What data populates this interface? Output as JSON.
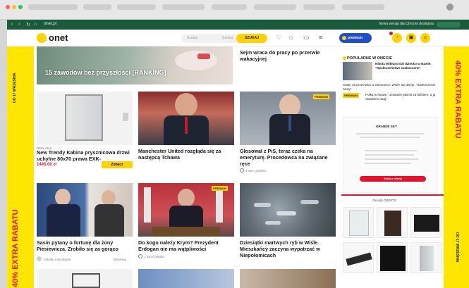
{
  "browser": {
    "url": "onet.pl",
    "update_notice": "Nowa wersja dla Chrome dostępna"
  },
  "header": {
    "logo": "onet",
    "search_placeholder": "Szukaj",
    "search_mid": "Szukaj",
    "search_button": "SZUKAJ",
    "premium_label": "premium"
  },
  "side_banner": {
    "left_big": "40% EXTRA RABATU",
    "left_small": "DO 17 WRZEŚNIA",
    "right_big": "40% EXTRA RABATU",
    "right_small": "DO 17 WRZEŚNIA"
  },
  "top_row": {
    "overlay_title": "15 zawodów bez przyszłości [RANKING]",
    "right_title": "Sejm wraca do pracy po przerwie wakacyjnej"
  },
  "row2": [
    {
      "title": "New Trendy Kabina prysznicowa drzwi uchylne 80x70 prawa EXK-",
      "price": "1445.00 zł",
      "button": "Zobacz",
      "meta": "REKLAMA"
    },
    {
      "title": "Manchester United rozgląda się za następcą Tchawa",
      "meta": ""
    },
    {
      "title": "Głosował z PiS, teraz czeka na emeryturę. Procedowca na związane ręce",
      "meta": "1 min czytania",
      "tag": "PREMIUM"
    }
  ],
  "row3": [
    {
      "title": "Sasin pytany o fortunę dla żony Piesiewicza. Zrobiło się za gorąco",
      "meta_left": "Szkoła, mieszkanie",
      "meta_right": "Obserwuj"
    },
    {
      "title": "Do kogo należy Krym? Prezydent Erdogan nie ma wątpliwości",
      "meta": "1 min czytania",
      "tag": "PREMIUM"
    },
    {
      "title": "Dziesiątki martwych ryb w Wiśle. Mieszkańcy zaczyna wypatrzać w Niepołomicach"
    }
  ],
  "right_column": {
    "section": "POPULARNE W ONECIE",
    "story1": "Nikola Wiklund dał dziecko w Nawie. \"Społeczeństwo zaskoczone\"",
    "story2": "Salon na przeciwko w Sosnowcu. Wiele się dzieje. \"Zaskoczenie nowy\"",
    "story3_tag": "PREMIUM",
    "story3": "Polka w Nowie. \"Zostanie jakimś za łóżkiem, a ja widokiem obaj\"",
    "ad_brand": "GRANDE SKY",
    "ad_caption": "Zasady OBERTE",
    "ad_button": "Zobacz ofertę"
  },
  "colors": {
    "brand_yellow": "#ffd200",
    "banner_yellow": "#ffe600",
    "banner_red": "#e8102d",
    "premium_blue": "#1f4fd1",
    "chrome_green": "#1a5a3d"
  },
  "icons": [
    "heart-icon",
    "bell-icon",
    "chat-icon",
    "menu-icon",
    "cart-icon",
    "user-icon"
  ]
}
